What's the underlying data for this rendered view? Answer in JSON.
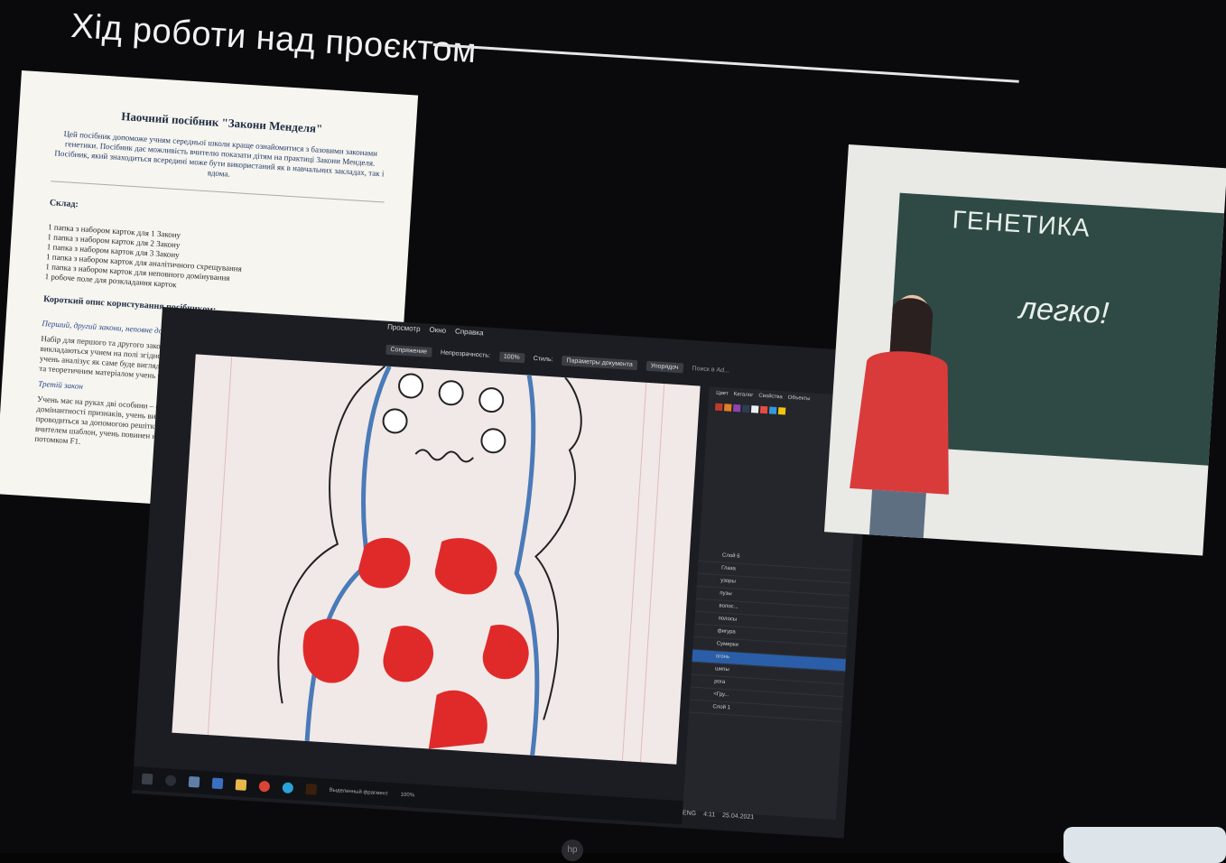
{
  "slide": {
    "title": "Хід роботи над проєктом"
  },
  "document": {
    "title": "Наочний посібник \"Закони Менделя\"",
    "intro": "Цей посібник допоможе учням середньої школи краще ознайомитися з базовими законами генетики. Посібник дає можливість вчителю показати дітям на практиці Закони Менделя. Посібник, який знаходиться всередині може бути використаний як в навчальних закладах, так і вдома.",
    "section_composition": "Склад:",
    "items": [
      "1 папка з набором карток для 1 Закону",
      "1 папка з набором карток для 2 Закону",
      "1 папка з набором карток для 3 Закону",
      "1 папка з набором карток для аналітичного схрещування",
      "1 папка з набором карток для неповного домінування",
      "1 робоче поле для розкладання карток"
    ],
    "section_usage": "Короткий опис користування посібником:",
    "usage_italic": "Перший, другий закони, неповне домінування, аналітичне схрещування",
    "usage_text": "Набір для першого та другого законів складається з робочого поля та карток. Картки викладаються учнем на полі згідно з вказівками на ньому. Вносячи дані у решітку Пеннета, учень аналізує як саме буде виглядати потомок F1. Згідно з картками на полі, решіткою Пеннета та теоретичним матеріалом учень повинен намалювати потомка F1.",
    "third_law": "Третій закон",
    "third_text": "Учень має на руках дві особини – самку і самця. Порівнюючи самку і самця з таблицею домінантності признаків, учень виписує, які признаки будуть проявлятися у фенотипі. Аналіз проводиться за допомогою решітки Пеннета. Маючи готовий, роздрукований попередньо вчителем шаблон, учень повинен намалювати на ній істоту, яка за геномом та фенотипом буде потомком F1."
  },
  "app": {
    "menu": [
      "Просмотр",
      "Окно",
      "Справка"
    ],
    "toolbar": [
      "Сопряжение",
      "Непрозрачность:",
      "100%",
      "Стиль:",
      "Параметры документа",
      "Упорядоч"
    ],
    "search_placeholder": "Поиск в Ad...",
    "panel_tabs": [
      "Цвет",
      "Каталог",
      "Свойства",
      "Объекты"
    ],
    "layers": [
      "Слой 6",
      "Глаза",
      "узоры",
      "пузы",
      "волос...",
      "полосы",
      "фигура",
      "Сумерки",
      "огонь",
      "шипы",
      "рога",
      "<Гру...",
      "Слой 1"
    ],
    "selected_layer_index": 8,
    "bottom_label": "Выделенный фрагмент",
    "zoom": "100%",
    "swatch_colors": [
      "#c0392b",
      "#e67e22",
      "#8e44ad",
      "#2c3e50",
      "#ecf0f1",
      "#e74c3c",
      "#3498db",
      "#f1c40f"
    ],
    "tray": {
      "lang": "ENG",
      "time": "4:11",
      "date": "25.04.2021"
    }
  },
  "photo": {
    "board_title": "ГЕНЕТИКА",
    "board_word": "легко!"
  },
  "colors": {
    "accent_red": "#e02a2a",
    "accent_blue": "#4a7bb8",
    "sweater_red": "#d93b3b",
    "board_green": "#2f4a45"
  }
}
